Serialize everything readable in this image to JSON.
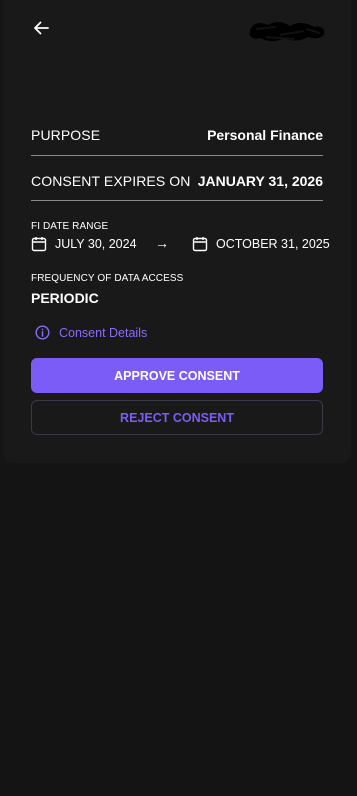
{
  "header": {
    "back_icon": "arrow-left-icon",
    "logo": "redacted-logo"
  },
  "purpose": {
    "label": "PURPOSE",
    "value": "Personal Finance"
  },
  "consent_expiry": {
    "label": "CONSENT EXPIRES ON",
    "value": "JANUARY 31, 2026"
  },
  "fi_date_range": {
    "label": "FI DATE RANGE",
    "from": "JULY 30, 2024",
    "arrow": "→",
    "to": "OCTOBER 31, 2025",
    "icon": "calendar-icon"
  },
  "frequency": {
    "label": "FREQUENCY OF DATA ACCESS",
    "value": "PERIODIC"
  },
  "consent_details": {
    "label": "Consent Details",
    "icon": "info-icon"
  },
  "actions": {
    "approve_label": "APPROVE CONSENT",
    "reject_label": "REJECT CONSENT"
  },
  "colors": {
    "background": "#141414",
    "card": "#191919",
    "accent": "#7c5cf6",
    "link": "#8b6cf7"
  }
}
